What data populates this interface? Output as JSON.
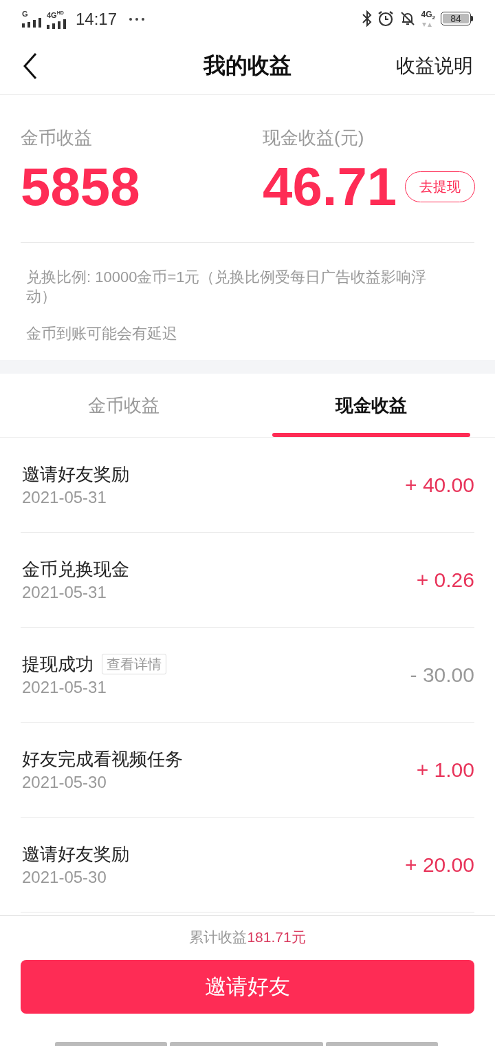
{
  "status_bar": {
    "sim1_network": "G",
    "sim2_network": "4G$^{HD}$",
    "time": "14:17",
    "data_network": "4G$_{2}$",
    "battery": "84"
  },
  "header": {
    "title": "我的收益",
    "action": "收益说明"
  },
  "summary": {
    "coins": {
      "label": "金币收益",
      "value": "5858"
    },
    "cash": {
      "label": "现金收益(元)",
      "value": "46.71"
    },
    "withdraw_button": "去提现",
    "notes": [
      "兑换比例: 10000金币=1元（兑换比例受每日广告收益影响浮动）",
      "金币到账可能会有延迟"
    ]
  },
  "tabs": [
    {
      "label": "金币收益",
      "selected": false
    },
    {
      "label": "现金收益",
      "selected": true
    }
  ],
  "records": [
    {
      "title": "邀请好友奖励",
      "date": "2021-05-31",
      "amount": "+ 40.00",
      "kind": "credit"
    },
    {
      "title": "金币兑换现金",
      "date": "2021-05-31",
      "amount": "+ 0.26",
      "kind": "credit"
    },
    {
      "title": "提现成功",
      "tag": "查看详情",
      "date": "2021-05-31",
      "amount": "- 30.00",
      "kind": "debit"
    },
    {
      "title": "好友完成看视频任务",
      "date": "2021-05-30",
      "amount": "+ 1.00",
      "kind": "credit"
    },
    {
      "title": "邀请好友奖励",
      "date": "2021-05-30",
      "amount": "+ 20.00",
      "kind": "credit"
    }
  ],
  "footer": {
    "total_label": "累计收益",
    "total_value": "181.71元",
    "invite_button": "邀请好友"
  }
}
